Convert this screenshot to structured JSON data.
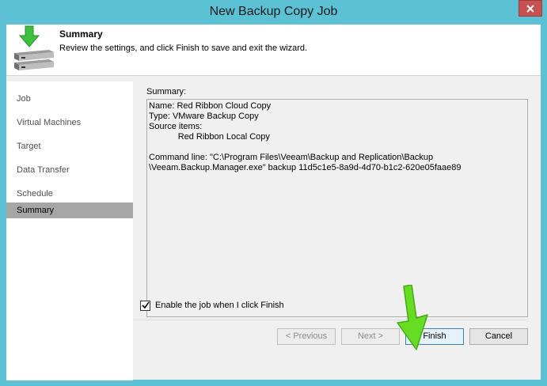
{
  "window": {
    "title": "New Backup Copy Job"
  },
  "header": {
    "title": "Summary",
    "description": "Review the settings, and click Finish to save and exit the wizard."
  },
  "nav": {
    "items": [
      {
        "label": "Job",
        "active": false
      },
      {
        "label": "Virtual Machines",
        "active": false
      },
      {
        "label": "Target",
        "active": false
      },
      {
        "label": "Data Transfer",
        "active": false
      },
      {
        "label": "Schedule",
        "active": false
      },
      {
        "label": "Summary",
        "active": true
      }
    ]
  },
  "summary": {
    "label": "Summary:",
    "text": "Name: Red Ribbon Cloud Copy\nType: VMware Backup Copy\nSource items:\n            Red Ribbon Local Copy\n\nCommand line: \"C:\\Program Files\\Veeam\\Backup and Replication\\Backup\n\\Veeam.Backup.Manager.exe\" backup 11d5c1e5-8a9d-4d70-b1c2-620e05faae89"
  },
  "options": {
    "enable_job_label": "Enable the job when I click Finish",
    "enable_job_checked": true
  },
  "buttons": {
    "previous": "< Previous",
    "next": "Next >",
    "finish": "Finish",
    "cancel": "Cancel"
  },
  "colors": {
    "title_bar": "#5cc1d5",
    "close_button": "#c75050",
    "nav_active": "#a6a6a6",
    "arrow": "#66dd22"
  },
  "icons": {
    "header": "backup-server-download-icon",
    "close": "close-icon",
    "check": "checkmark-icon",
    "annotation": "green-arrow-icon"
  }
}
